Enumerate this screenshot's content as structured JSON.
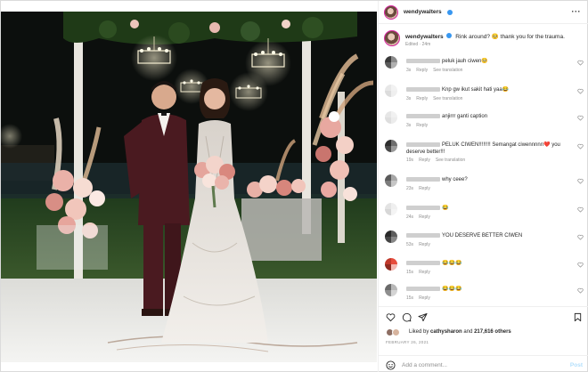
{
  "post": {
    "username": "wendywalters",
    "more_icon": "···"
  },
  "caption": {
    "username": "wendywalters",
    "text": "Rink around? 🥺 thank you for the trauma.",
    "meta": "Edited · 24m"
  },
  "comments": [
    {
      "text": "peluk jauh ciwen🥺",
      "age": "3s",
      "reply": "Reply",
      "translate": "See translation",
      "avatar_colors": [
        "#3a3a3a",
        "#8a8a8a",
        "#5b5b5b",
        "#b0b0b0"
      ]
    },
    {
      "text": "Knp gw ikut sakit hati yaa😂",
      "age": "3s",
      "reply": "Reply",
      "translate": "See translation",
      "avatar_colors": [
        "#e7e7e7",
        "#f2f2f2",
        "#dcdcdc",
        "#efefef"
      ]
    },
    {
      "text": "anjirrr ganti caption",
      "age": "3s",
      "reply": "Reply",
      "translate": "",
      "avatar_colors": [
        "#e6e6e6",
        "#f1f1f1",
        "#dedede",
        "#ececec"
      ]
    },
    {
      "text": "PELUK CIWEN!!!!!!!! Semangat ciwennnnn❤️ you deserve better!!!",
      "age": "19s",
      "reply": "Reply",
      "translate": "See translation",
      "avatar_colors": [
        "#2e2e2e",
        "#6e6e6e",
        "#4a4a4a",
        "#9a9a9a"
      ]
    },
    {
      "text": "why ceee?",
      "age": "23s",
      "reply": "Reply",
      "translate": "",
      "avatar_colors": [
        "#5a5a5a",
        "#a7a7a7",
        "#7c7c7c",
        "#c6c6c6"
      ]
    },
    {
      "text": "😂",
      "age": "24s",
      "reply": "Reply",
      "translate": "",
      "avatar_colors": [
        "#e3e3e3",
        "#efefef",
        "#d7d7d7",
        "#f4f4f4"
      ]
    },
    {
      "text": "YOU DESERVE BETTER CIWEN",
      "age": "53s",
      "reply": "Reply",
      "translate": "",
      "avatar_colors": [
        "#2a2a2a",
        "#5d5d5d",
        "#454545",
        "#878787"
      ]
    },
    {
      "text": "😂😂😂",
      "age": "15s",
      "reply": "Reply",
      "translate": "",
      "avatar_colors": [
        "#c0392b",
        "#e74c3c",
        "#8e2b20",
        "#f5b7b1"
      ]
    },
    {
      "text": "😂😂😂",
      "age": "15s",
      "reply": "Reply",
      "translate": "",
      "avatar_colors": [
        "#6a6a6a",
        "#b8b8b8",
        "#8f8f8f",
        "#d4d4d4"
      ]
    }
  ],
  "actions": {
    "like_icon": "heart-icon",
    "comment_icon": "comment-icon",
    "share_icon": "send-icon",
    "save_icon": "bookmark-icon"
  },
  "likes": {
    "prefix": "Liked by",
    "first_user": "cathysharon",
    "joiner": "and",
    "others": "217,616 others"
  },
  "date": "FEBRUARY 26, 2021",
  "add_comment": {
    "placeholder": "Add a comment...",
    "post_label": "Post",
    "emoji_icon": "smiley-icon"
  },
  "colors": {
    "verified": "#3897f0",
    "meta_gray": "#8e8e8e",
    "border": "#efefef",
    "post_button_disabled": "#b2dffc"
  }
}
